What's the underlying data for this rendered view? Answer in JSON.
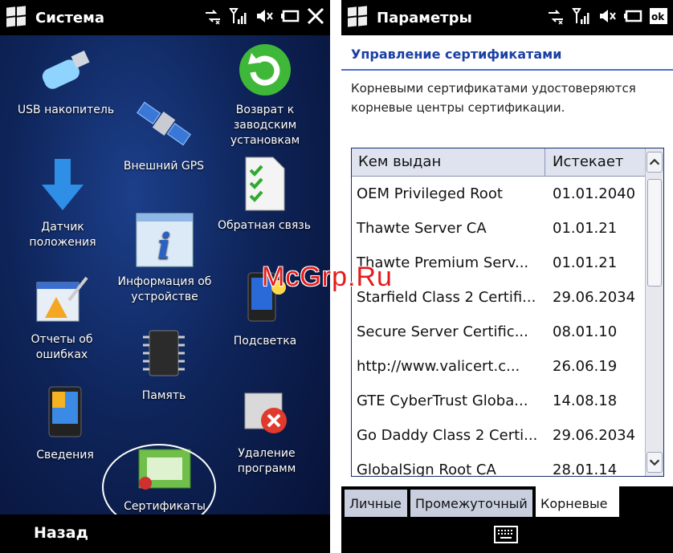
{
  "left": {
    "title": "Система",
    "back_label": "Назад",
    "apps": [
      {
        "label": "USB накопитель",
        "icon": "usb-drive-icon"
      },
      {
        "label": "Возврат к заводским установкам",
        "icon": "reset-arrow-icon"
      },
      {
        "label": "Внешний GPS",
        "icon": "satellite-icon"
      },
      {
        "label": "Датчик положения",
        "icon": "down-arrow-icon"
      },
      {
        "label": "Обратная связь",
        "icon": "checklist-icon"
      },
      {
        "label": "Информация об устройстве",
        "icon": "info-icon"
      },
      {
        "label": "Отчеты об ошибках",
        "icon": "warning-report-icon"
      },
      {
        "label": "Подсветка",
        "icon": "backlight-phone-icon"
      },
      {
        "label": "Память",
        "icon": "memory-chip-icon"
      },
      {
        "label": "Сведения",
        "icon": "phone-info-icon"
      },
      {
        "label": "Удаление программ",
        "icon": "remove-program-icon"
      },
      {
        "label": "Сертификаты",
        "icon": "certificate-icon"
      }
    ]
  },
  "right": {
    "title": "Параметры",
    "section_title": "Управление сертификатами",
    "description": "Корневыми сертификатами удостоверяются корневые центры сертификации.",
    "columns": {
      "issuer": "Кем выдан",
      "expires": "Истекает"
    },
    "rows": [
      {
        "issuer": "OEM Privileged Root",
        "expires": "01.01.2040"
      },
      {
        "issuer": "Thawte Server CA",
        "expires": "01.01.21"
      },
      {
        "issuer": "Thawte Premium Serv...",
        "expires": "01.01.21"
      },
      {
        "issuer": "Starfield Class 2 Certifi...",
        "expires": "29.06.2034"
      },
      {
        "issuer": "Secure Server Certific...",
        "expires": "08.01.10"
      },
      {
        "issuer": "http://www.valicert.c...",
        "expires": "26.06.19"
      },
      {
        "issuer": "GTE CyberTrust Globa...",
        "expires": "14.08.18"
      },
      {
        "issuer": "Go Daddy Class 2 Certi...",
        "expires": "29.06.2034"
      },
      {
        "issuer": "GlobalSign Root CA",
        "expires": "28.01.14"
      }
    ],
    "tabs": [
      "Личные",
      "Промежуточный",
      "Корневые"
    ],
    "active_tab": "Корневые"
  },
  "watermark": "McGrp.Ru",
  "colors": {
    "accent": "#1a3fa5",
    "desktop": "#0e2459"
  }
}
